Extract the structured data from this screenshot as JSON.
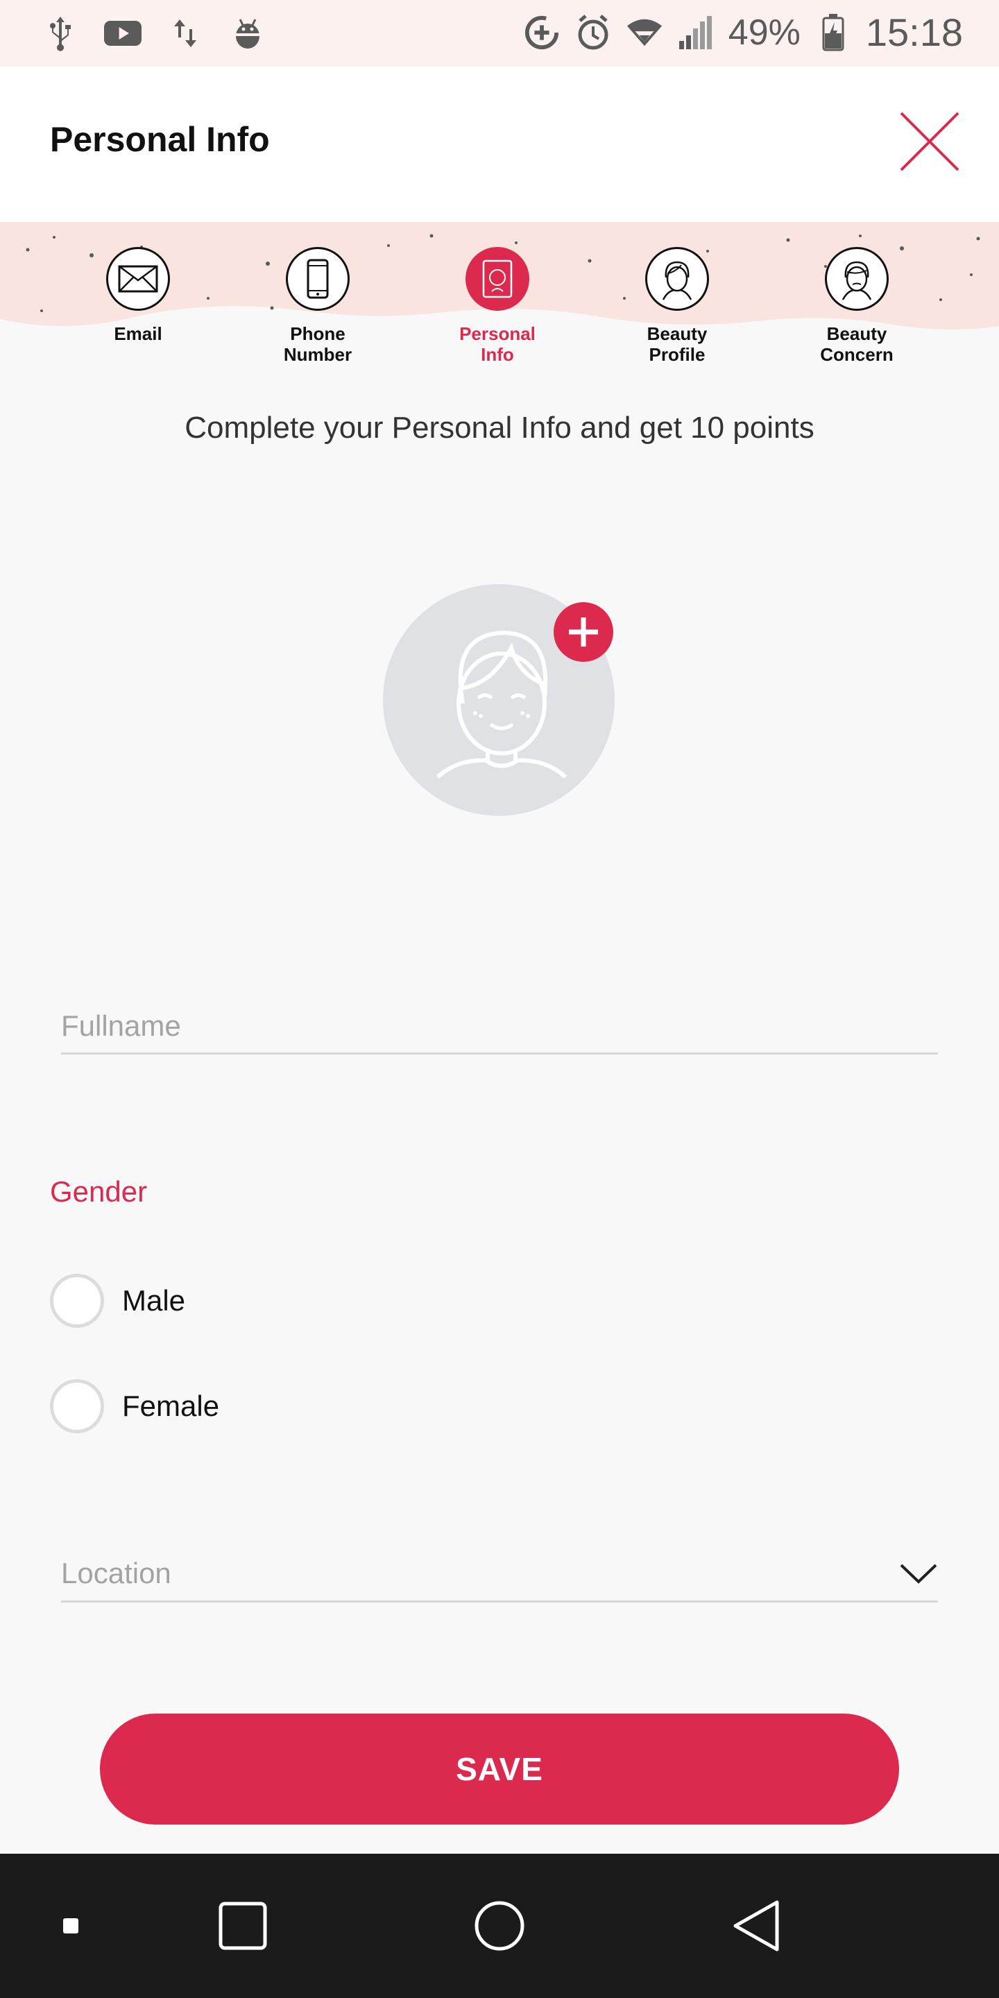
{
  "status_bar": {
    "battery": "49%",
    "time": "15:18",
    "left_icons": [
      "usb-icon",
      "youtube-icon",
      "data-transfer-icon",
      "android-debug-icon"
    ],
    "right_icons": [
      "data-saver-icon",
      "alarm-icon",
      "wifi-icon",
      "signal-icon",
      "battery-icon"
    ]
  },
  "header": {
    "title": "Personal Info",
    "close_icon": "close-icon"
  },
  "steps": [
    {
      "label": "Email",
      "icon": "envelope-icon",
      "active": false
    },
    {
      "label": "Phone\nNumber",
      "icon": "phone-icon",
      "active": false
    },
    {
      "label": "Personal\nInfo",
      "icon": "personal-info-icon",
      "active": true
    },
    {
      "label": "Beauty\nProfile",
      "icon": "face-icon",
      "active": false
    },
    {
      "label": "Beauty\nConcern",
      "icon": "face-concern-icon",
      "active": false
    }
  ],
  "subtitle": "Complete your Personal Info and get 10 points",
  "form": {
    "fullname_placeholder": "Fullname",
    "gender_label": "Gender",
    "gender_options": [
      "Male",
      "Female"
    ],
    "location_placeholder": "Location",
    "save_label": "SAVE"
  },
  "colors": {
    "accent": "#dc2a4e",
    "status_bg": "#fbf1ee",
    "page_bg": "#f8f8f8",
    "navbar_bg": "#1b1b1b"
  }
}
